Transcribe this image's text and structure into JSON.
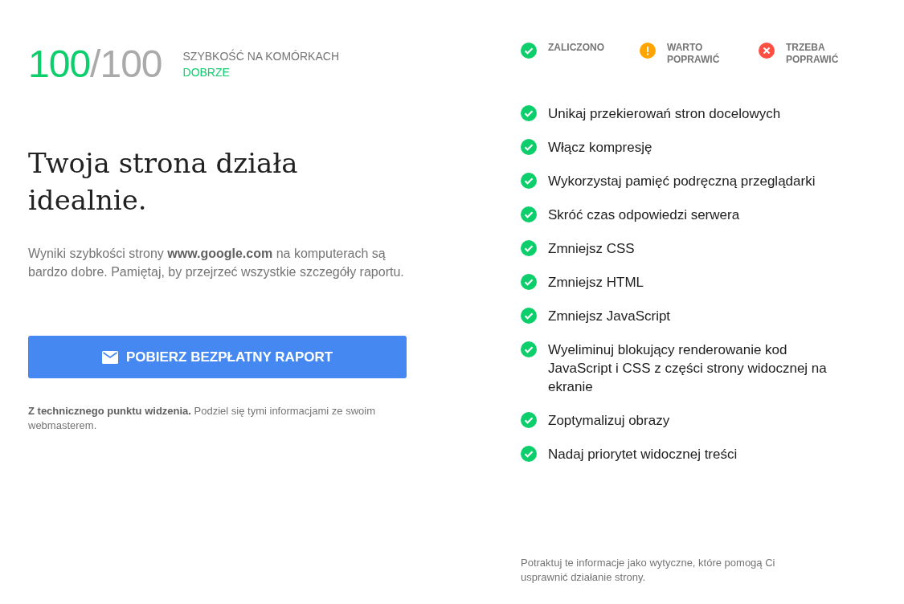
{
  "score": {
    "value": "100",
    "max": "/100",
    "label": "SZYBKOŚĆ NA KOMÓRKACH",
    "rating": "DOBRZE"
  },
  "headline": "Twoja strona działa idealnie.",
  "summary": "Wyniki szybkości strony **www.google.com** na komputerach są bardzo dobre. Pamiętaj, by przejrzeć wszystkie szczegóły raportu.",
  "button": {
    "label": "POBIERZ BEZPŁATNY RAPORT"
  },
  "tech_note": "**Z technicznego punktu widzenia.** Podziel się tymi informacjami ze swoim webmasterem.",
  "legend": [
    {
      "kind": "pass",
      "label": "ZALICZONO"
    },
    {
      "kind": "warn",
      "label": "WARTO POPRAWIĆ"
    },
    {
      "kind": "fail",
      "label": "TRZEBA POPRAWIĆ"
    }
  ],
  "rules": [
    {
      "kind": "pass",
      "label": "Unikaj przekierowań stron docelowych"
    },
    {
      "kind": "pass",
      "label": "Włącz kompresję"
    },
    {
      "kind": "pass",
      "label": "Wykorzystaj pamięć podręczną przeglądarki"
    },
    {
      "kind": "pass",
      "label": "Skróć czas odpowiedzi serwera"
    },
    {
      "kind": "pass",
      "label": "Zmniejsz CSS"
    },
    {
      "kind": "pass",
      "label": "Zmniejsz HTML"
    },
    {
      "kind": "pass",
      "label": "Zmniejsz JavaScript"
    },
    {
      "kind": "pass",
      "label": "Wyeliminuj blokujący renderowanie kod JavaScript i CSS z części strony widocznej na ekranie"
    },
    {
      "kind": "pass",
      "label": "Zoptymalizuj obrazy"
    },
    {
      "kind": "pass",
      "label": "Nadaj priorytet widocznej treści"
    }
  ],
  "footnote": "Potraktuj te informacje jako wytyczne, które pomogą Ci usprawnić działanie strony."
}
